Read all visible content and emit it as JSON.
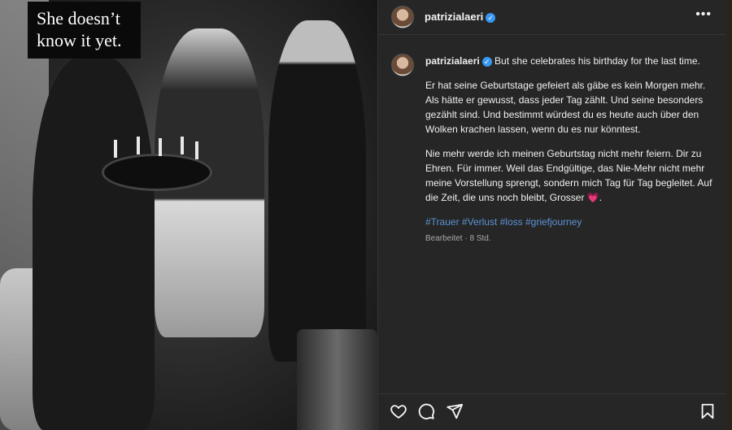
{
  "photo": {
    "caption_line1": "She doesn’t",
    "caption_line2": "know it yet."
  },
  "header": {
    "username": "patrizialaeri",
    "verified_icon": "verified-badge-icon",
    "more_icon": "more-options-icon"
  },
  "post": {
    "username": "patrizialaeri",
    "first_line": "But she celebrates his birthday for the last time.",
    "para1": "Er hat seine Geburtstage gefeiert als gäbe es kein Morgen mehr. Als hätte er gewusst, dass jeder Tag zählt. Und seine besonders gezählt sind. Und bestimmt würdest du es heute auch über den Wolken krachen lassen, wenn du es nur könntest.",
    "para2": "Nie mehr werde ich meinen Geburtstag nicht mehr feiern. Dir zu Ehren. Für immer. Weil das Endgültige, das Nie-Mehr nicht mehr meine Vorstellung sprengt, sondern mich Tag für Tag begleitet. Auf die Zeit, die uns noch bleibt, Grosser",
    "para2_end": ".",
    "heart_emoji": "💗",
    "hashtags": [
      "#Trauer",
      "#Verlust",
      "#loss",
      "#griefjourney"
    ],
    "edited": "Bearbeitet",
    "separator": "·",
    "time": "8 Std."
  },
  "actions": {
    "icons": [
      "heart-icon",
      "comment-icon",
      "share-icon",
      "bookmark-icon"
    ]
  },
  "colors": {
    "background": "#262626",
    "link": "#5b93d4",
    "verified": "#3897f0"
  }
}
